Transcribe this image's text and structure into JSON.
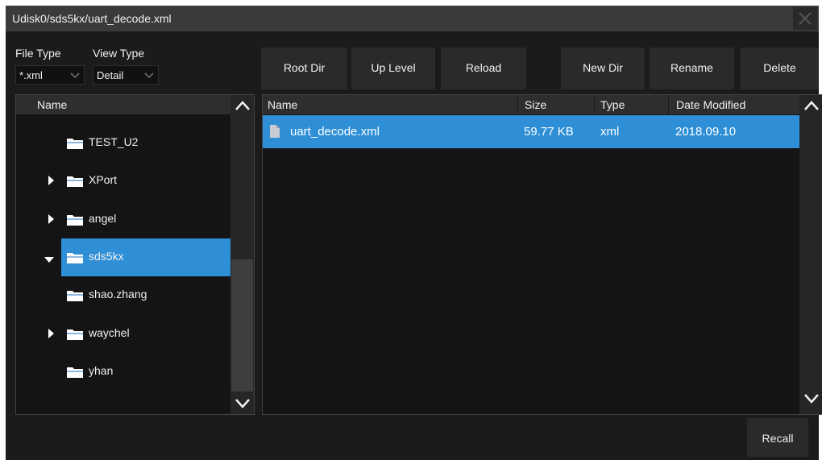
{
  "window": {
    "title": "Udisk0/sds5kx/uart_decode.xml"
  },
  "filters": {
    "file_type_label": "File Type",
    "file_type_value": "*.xml",
    "view_type_label": "View Type",
    "view_type_value": "Detail"
  },
  "toolbar": {
    "root_dir": "Root Dir",
    "up_level": "Up Level",
    "reload": "Reload",
    "new_dir": "New Dir",
    "rename": "Rename",
    "delete": "Delete"
  },
  "tree": {
    "header": "Name",
    "items": [
      {
        "label": "TEST_U2",
        "expandable": false,
        "expanded": false,
        "selected": false
      },
      {
        "label": "XPort",
        "expandable": true,
        "expanded": false,
        "selected": false
      },
      {
        "label": "angel",
        "expandable": true,
        "expanded": false,
        "selected": false
      },
      {
        "label": "sds5kx",
        "expandable": true,
        "expanded": true,
        "selected": true
      },
      {
        "label": "shao.zhang",
        "expandable": false,
        "expanded": false,
        "selected": false
      },
      {
        "label": "waychel",
        "expandable": true,
        "expanded": false,
        "selected": false
      },
      {
        "label": "yhan",
        "expandable": false,
        "expanded": false,
        "selected": false
      }
    ]
  },
  "files": {
    "columns": {
      "name": "Name",
      "size": "Size",
      "type": "Type",
      "date": "Date Modified"
    },
    "rows": [
      {
        "name": "uart_decode.xml",
        "size": "59.77 KB",
        "type": "xml",
        "date": "2018.09.10"
      }
    ]
  },
  "footer": {
    "recall": "Recall"
  },
  "colors": {
    "accent": "#2e8fd6",
    "background": "#1b1b1b",
    "folder": "#ffffff"
  }
}
